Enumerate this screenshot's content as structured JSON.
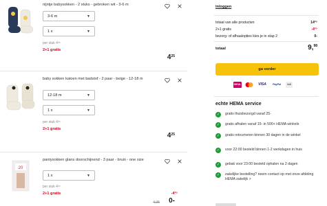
{
  "cart": {
    "items": [
      {
        "title": "nijntje babysokken - 2 stuks - gebroken wit - 3-6 m",
        "size": "3-6 m",
        "qty": "1 x",
        "per_stuk": "per stuk 4²⁵",
        "promo": "2+1 gratis",
        "price_int": "4",
        "price_dec": "25"
      },
      {
        "title": "baby sokken katoen met badstof - 2 paar - beige - 12-18 m",
        "size": "12-18 m",
        "qty": "1 x",
        "per_stuk": "per stuk 4²⁵",
        "promo": "2+1 gratis",
        "price_int": "4",
        "price_dec": "25"
      },
      {
        "title": "pantysokken glans doorschijnend - 3 paar - bruin - one size",
        "qty": "1 x",
        "per_stuk": "per stuk 4²⁵",
        "promo": "2+1 gratis",
        "old_price": "4,25",
        "discount": "-4²⁵",
        "price_int": "0",
        "price_dec": "-"
      }
    ]
  },
  "summary": {
    "login_link": "inloggen",
    "rows": [
      {
        "label": "totaal van alle producten",
        "value": "14²⁵"
      },
      {
        "label": "2+1 gratis",
        "value": "-4²⁵"
      },
      {
        "label": "bezorg- of afhaalopties kies je in stap 2",
        "value": "0-"
      }
    ],
    "total_label": "totaal",
    "total_int": "9",
    "total_dec": "98",
    "cta_label": "ga verder",
    "payments": [
      "iDEAL",
      "Mastercard",
      "VISA",
      "PayPal",
      "in3"
    ],
    "service_title": "echte HEMA service",
    "service_items": [
      "gratis thuisbezorgd vanaf 25-",
      "gratis afhalen vanaf 15- in 500+ HEMA winkels",
      "gratis retourneren binnen 30 dagen in de winkel",
      "voor 22:00 besteld binnen 1-2 werkdagen in huis",
      "gebak voor 23:00 besteld ophalen na 2 dagen",
      "zakelijke bestelling? neem contact op met onze afdeling HEMA zakelijk >"
    ]
  },
  "colors": {
    "accent": "#f6c20a",
    "promo": "#d6001c",
    "check": "#1e9c3a"
  }
}
